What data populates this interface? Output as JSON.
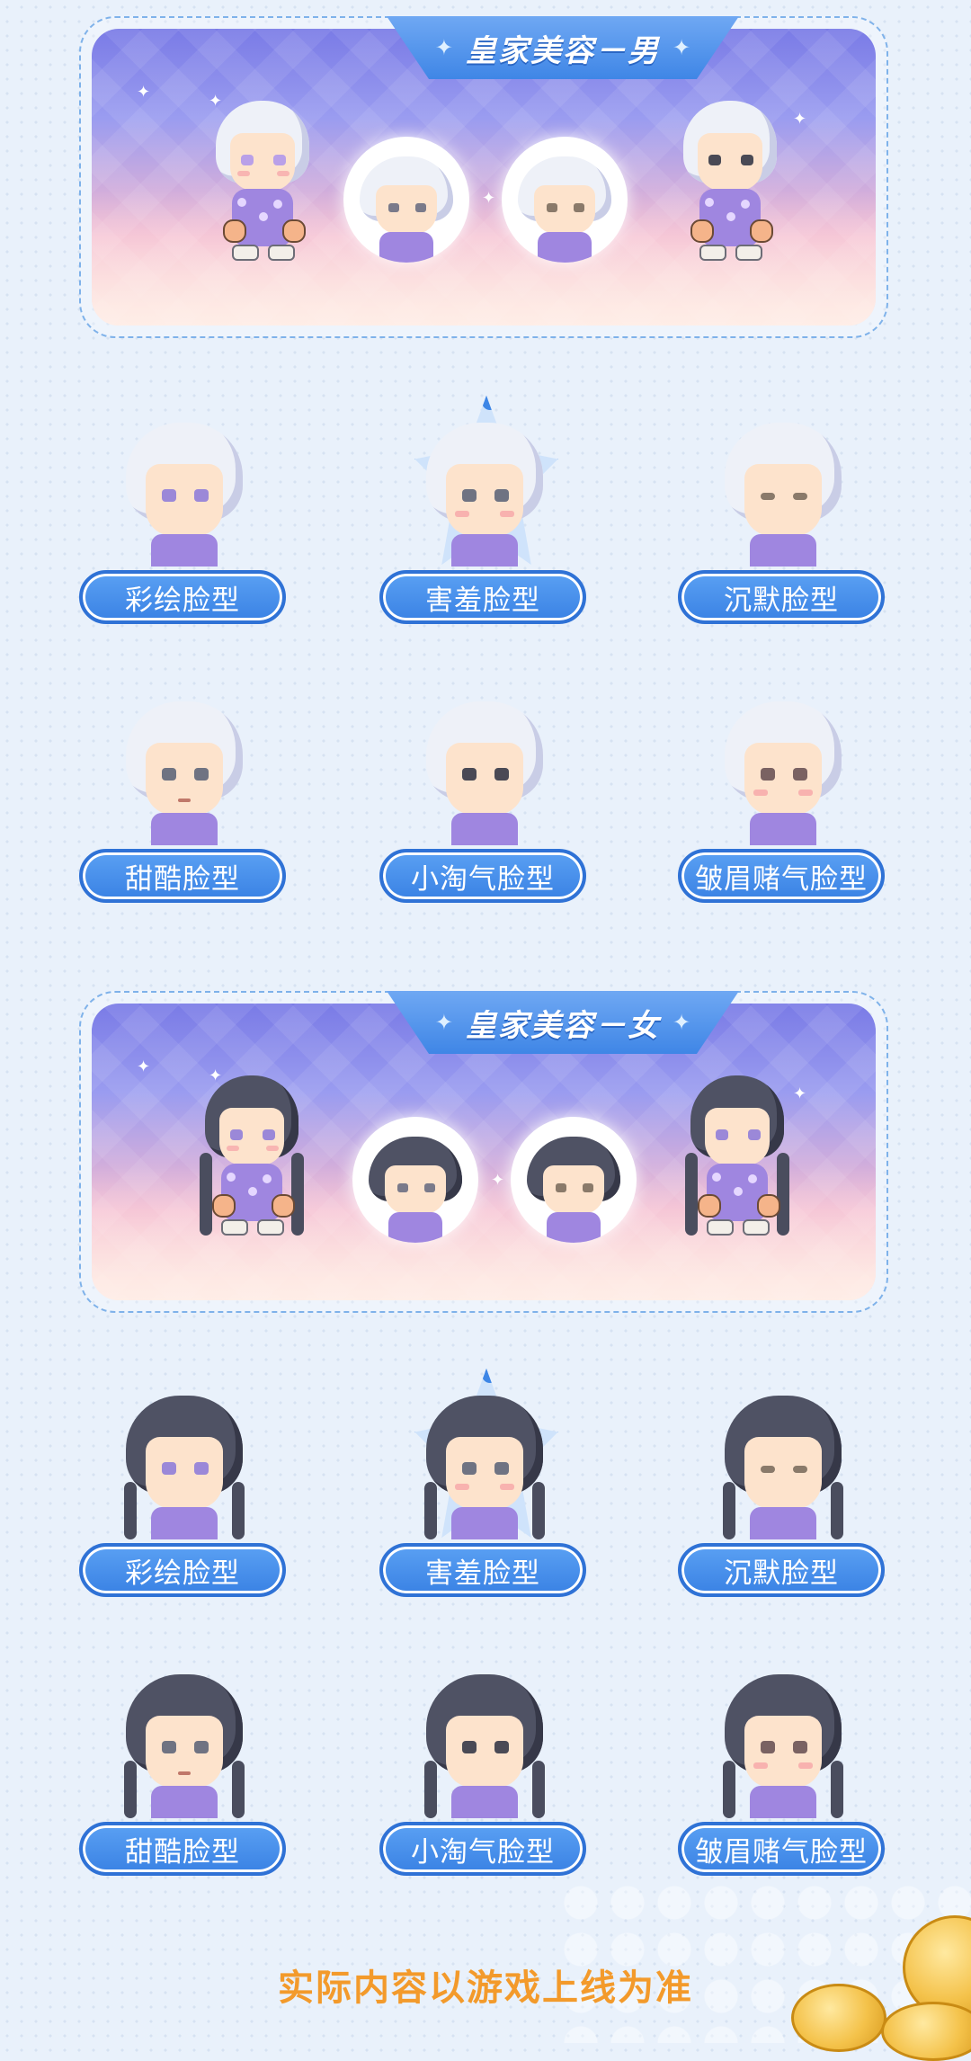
{
  "sections": [
    {
      "id": "male",
      "banner_title": "皇家美容－男",
      "hair_color": "#eef1f8",
      "hair_shadow": "#c9cde6",
      "items": [
        {
          "label": "彩绘脸型",
          "eye_color": "#9b88d8"
        },
        {
          "label": "害羞脸型",
          "eye_color": "#6f7382",
          "selected": true
        },
        {
          "label": "沉默脸型",
          "eye_color": "#8a7a6a"
        },
        {
          "label": "甜酷脸型",
          "eye_color": "#6f7382"
        },
        {
          "label": "小淘气脸型",
          "eye_color": "#4a4a55"
        },
        {
          "label": "皱眉赌气脸型",
          "eye_color": "#7a6262"
        }
      ]
    },
    {
      "id": "female",
      "banner_title": "皇家美容－女",
      "hair_color": "#4f5264",
      "hair_shadow": "#363848",
      "items": [
        {
          "label": "彩绘脸型",
          "eye_color": "#9b88d8"
        },
        {
          "label": "害羞脸型",
          "eye_color": "#6f7382",
          "selected": true
        },
        {
          "label": "沉默脸型",
          "eye_color": "#8a7a6a"
        },
        {
          "label": "甜酷脸型",
          "eye_color": "#6f7382"
        },
        {
          "label": "小淘气脸型",
          "eye_color": "#4a4a55"
        },
        {
          "label": "皱眉赌气脸型",
          "eye_color": "#7a6262"
        }
      ]
    }
  ],
  "footer": {
    "note": "实际内容以游戏上线为准"
  },
  "colors": {
    "accent": "#3a82e4",
    "note": "#f39a2b"
  }
}
